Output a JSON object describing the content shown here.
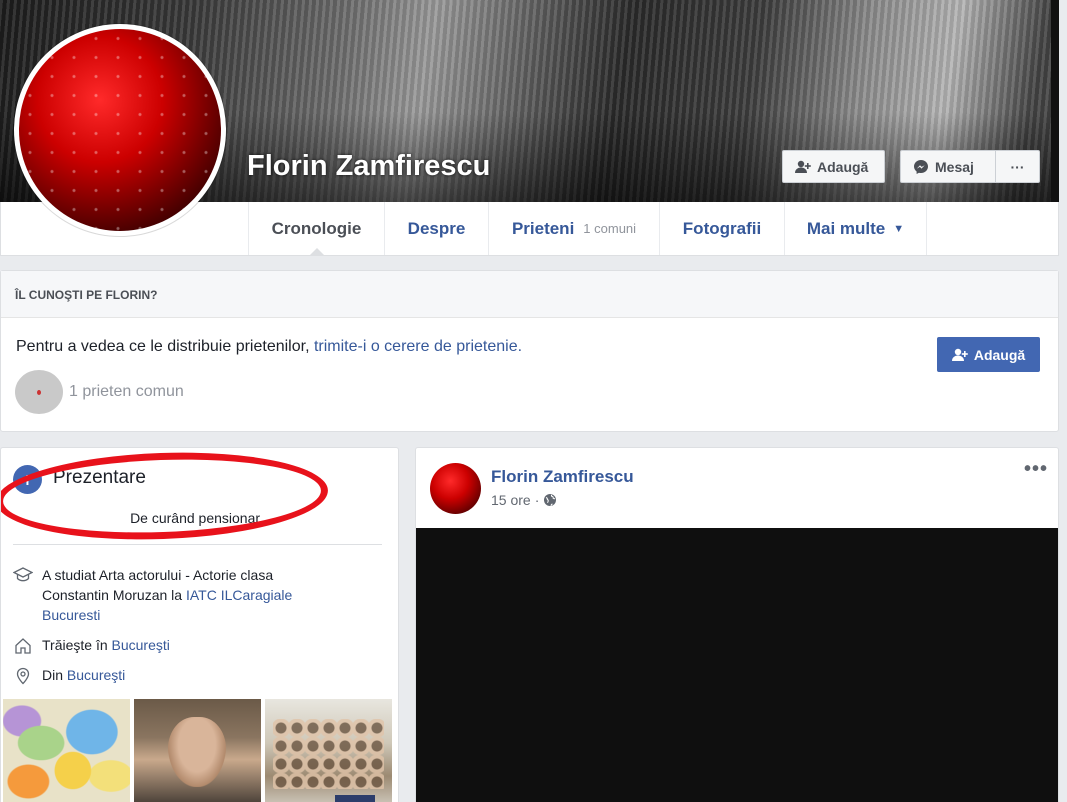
{
  "profile": {
    "name": "Florin Zamfirescu",
    "actions": {
      "add_friend": "Adaugă",
      "message": "Mesaj",
      "more": "···"
    }
  },
  "tabs": [
    {
      "label": "Cronologie",
      "active": true
    },
    {
      "label": "Despre"
    },
    {
      "label": "Prieteni",
      "sub": "1 comuni"
    },
    {
      "label": "Fotografii"
    },
    {
      "label": "Mai multe",
      "caret": "▼"
    }
  ],
  "know": {
    "heading": "ÎL CUNOŞTI PE FLORIN?",
    "text_prefix": "Pentru a vedea ce le distribuie prietenilor, ",
    "text_link": "trimite-i o cerere de prietenie.",
    "button": "Adaugă",
    "mutual": "1 prieten comun"
  },
  "intro": {
    "title": "Prezentare",
    "bio": "De curând pensionar...",
    "education_prefix": "A studiat Arta actorului - Actorie clasa Constantin Moruzan la ",
    "education_link": "IATC ILCaragiale Bucuresti",
    "lives_prefix": "Trăieşte în ",
    "lives_link": "Bucureşti",
    "from_prefix": "Din ",
    "from_link": "Bucureşti"
  },
  "post": {
    "author": "Florin Zamfirescu",
    "time": "15 ore",
    "separator": "·",
    "more": "•••"
  },
  "colors": {
    "link": "#365899",
    "primary_button": "#4267b2",
    "highlight_ellipse": "#e8121b",
    "page_bg": "#e9ebee"
  }
}
